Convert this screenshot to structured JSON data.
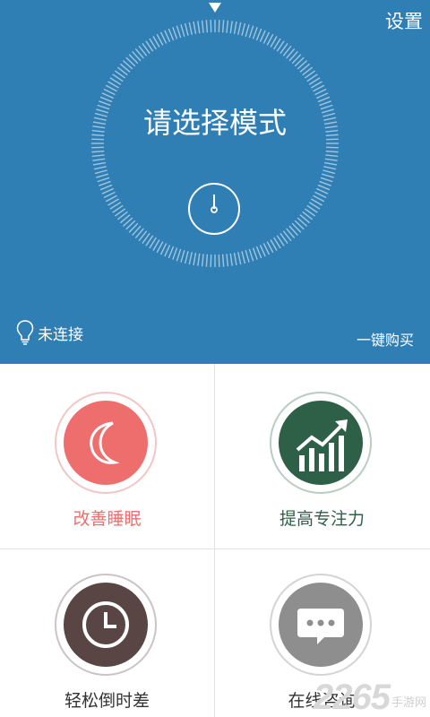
{
  "header": {
    "settings_label": "设置"
  },
  "dial": {
    "title": "请选择模式"
  },
  "status": {
    "connection": "未连接",
    "buy_label": "一键购买"
  },
  "modes": [
    {
      "label": "改善睡眠",
      "color": "#ee6e6e",
      "icon": "moon-icon"
    },
    {
      "label": "提高专注力",
      "color": "#2e6048",
      "icon": "rising-chart-icon"
    },
    {
      "label": "轻松倒时差",
      "color": "#5a4545",
      "icon": "clock-icon"
    },
    {
      "label": "在线咨询",
      "color": "#8e8e8e",
      "icon": "chat-bubble-icon"
    }
  ],
  "watermark": {
    "number": "2265",
    "text": "手游网"
  }
}
